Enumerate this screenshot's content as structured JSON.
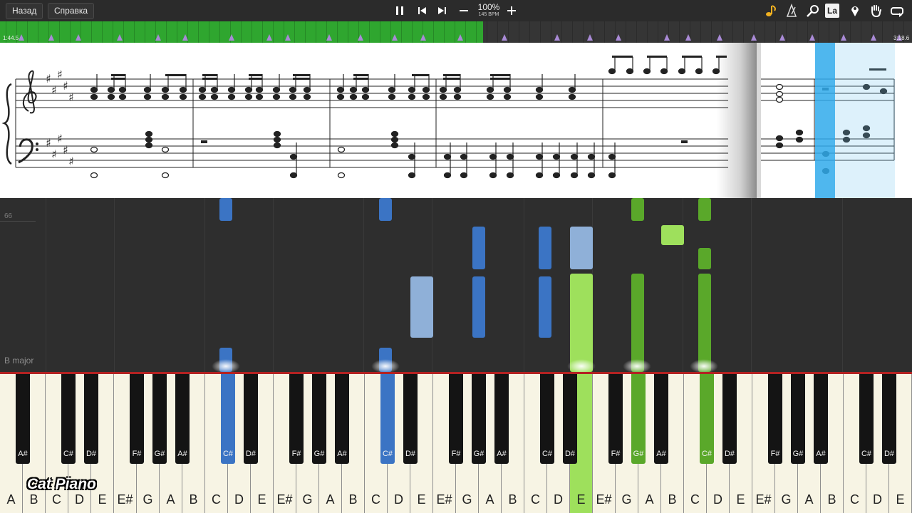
{
  "toolbar": {
    "back_label": "Назад",
    "help_label": "Справка",
    "tempo_percent": "100%",
    "tempo_bpm": "145 BPM",
    "icons": [
      "pause-icon",
      "skip-back-icon",
      "skip-forward-icon",
      "minus-icon",
      "plus-icon",
      "note-icon",
      "metronome-icon",
      "magnifier-icon",
      "label-icon",
      "map-pin-icon",
      "hand-icon",
      "loop-icon"
    ],
    "label_icon_text": "La"
  },
  "progress": {
    "current_time": "1:44.5",
    "total_time": "3:18.6",
    "fraction": 0.53,
    "colors": {
      "played": "#2fa62f",
      "remaining": "#353535",
      "marker": "#a98ad6"
    }
  },
  "roll": {
    "measure_number": "66",
    "key_signature_label": "B major",
    "colors": {
      "left_hand": "#3b74c4",
      "left_hand_light": "#8fb0d8",
      "right_hand": "#5aa82a",
      "right_hand_light": "#9ee05c"
    }
  },
  "keyboard": {
    "white_keys": [
      "A",
      "B",
      "C",
      "D",
      "E",
      "E#",
      "G",
      "A",
      "B",
      "C",
      "D",
      "E",
      "E#",
      "G",
      "A",
      "B",
      "C",
      "D",
      "E",
      "E#",
      "G",
      "A",
      "B",
      "C",
      "D",
      "E",
      "E#",
      "G",
      "A",
      "B",
      "C",
      "D",
      "E",
      "E#",
      "G",
      "A",
      "B",
      "C",
      "D",
      "E"
    ],
    "black_keys": [
      "A#",
      "C#",
      "D#",
      "F#",
      "G#",
      "A#",
      "C#",
      "D#",
      "F#",
      "G#",
      "A#",
      "C#",
      "D#",
      "F#",
      "G#",
      "A#",
      "C#",
      "D#",
      "F#",
      "G#",
      "A#",
      "C#",
      "D#",
      "F#",
      "G#",
      "A#",
      "C#",
      "D#"
    ],
    "pressed": [
      "C#",
      "C#",
      "E",
      "G#",
      "C#"
    ]
  },
  "branding": {
    "logo_text": "Cat Piano"
  }
}
